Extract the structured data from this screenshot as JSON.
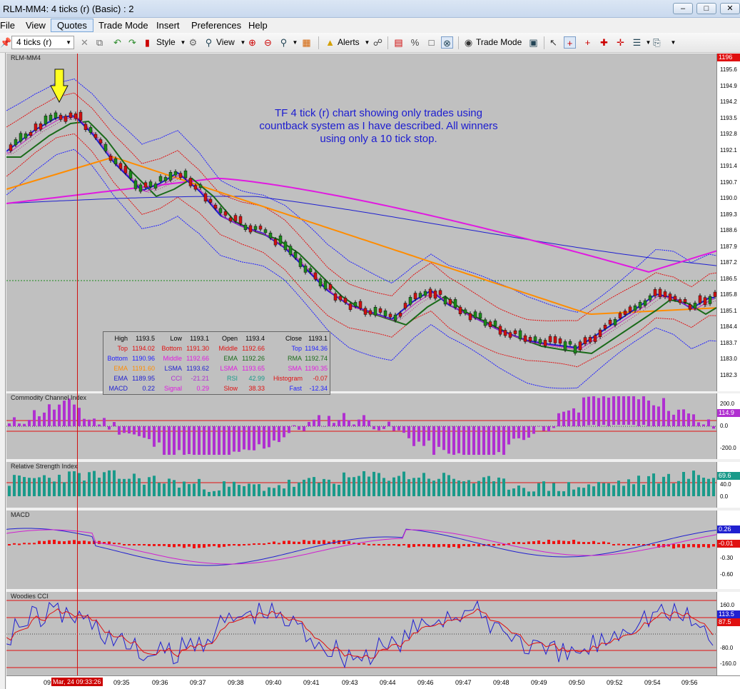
{
  "window": {
    "title": "RLM-MM4: 4 ticks (r) (Basic) : 2",
    "buttons": [
      "–",
      "□",
      "✕"
    ]
  },
  "menu": [
    "File",
    "View",
    "Quotes",
    "Trade Mode",
    "Insert",
    "Preferences",
    "Help"
  ],
  "toolbar": {
    "interval": "4 ticks (r)",
    "style_label": "Style",
    "view_label": "View",
    "alerts_label": "Alerts",
    "trade_mode_label": "Trade Mode"
  },
  "colors": {
    "panel_bg": "#c0c0c0",
    "bands_blue": "#1f1fff",
    "bands_red": "#e01010",
    "ema_green": "#1a6b1a",
    "ema_orange": "#ff8c00",
    "sma_magenta": "#e01ae0",
    "lsma_blue": "#2020d0",
    "cci_bar": "#b030d0",
    "rsi_bar": "#1a9a8a",
    "macd_bar": "#ee1111"
  },
  "main_panel": {
    "label": "RLM-MM4",
    "annotation": "TF 4 tick (r) chart showing only trades using countback system as I have described. All winners using only a 10 tick stop.",
    "price_ticks": [
      "1195.6",
      "1194.9",
      "1194.2",
      "1193.5",
      "1192.8",
      "1192.1",
      "1191.4",
      "1190.7",
      "1190.0",
      "1189.3",
      "1188.6",
      "1187.9",
      "1187.2",
      "1186.5",
      "1185.8",
      "1185.1",
      "1184.4",
      "1183.7",
      "1183.0",
      "1182.3"
    ],
    "last_price_tag": "1196"
  },
  "data_box": {
    "rows": [
      [
        [
          "High",
          "#000"
        ],
        [
          "1193.5",
          "#000"
        ],
        [
          "Low",
          "#000"
        ],
        [
          "1193.1",
          "#000"
        ],
        [
          "Open",
          "#000"
        ],
        [
          "1193.4",
          "#000"
        ],
        [
          "Close",
          "#000"
        ],
        [
          "1193.1",
          "#000"
        ]
      ],
      [
        [
          "Top",
          "#e01010"
        ],
        [
          "1194.02",
          "#e01010"
        ],
        [
          "Bottom",
          "#e01010"
        ],
        [
          "1191.30",
          "#e01010"
        ],
        [
          "Middle",
          "#e01010"
        ],
        [
          "1192.66",
          "#e01010"
        ],
        [
          "Top",
          "#1f1fff"
        ],
        [
          "1194.36",
          "#1f1fff"
        ]
      ],
      [
        [
          "Bottom",
          "#1f1fff"
        ],
        [
          "1190.96",
          "#1f1fff"
        ],
        [
          "Middle",
          "#e01ae0"
        ],
        [
          "1192.66",
          "#e01ae0"
        ],
        [
          "EMA",
          "#1a6b1a"
        ],
        [
          "1192.26",
          "#1a6b1a"
        ],
        [
          "RMA",
          "#1a6b1a"
        ],
        [
          "1192.74",
          "#1a6b1a"
        ]
      ],
      [
        [
          "EMA",
          "#ff8c00"
        ],
        [
          "1191.60",
          "#ff8c00"
        ],
        [
          "LSMA",
          "#2020d0"
        ],
        [
          "1193.62",
          "#2020d0"
        ],
        [
          "LSMA",
          "#e01ae0"
        ],
        [
          "1193.65",
          "#e01ae0"
        ],
        [
          "SMA",
          "#e01ae0"
        ],
        [
          "1190.35",
          "#e01ae0"
        ]
      ],
      [
        [
          "EMA",
          "#2020d0"
        ],
        [
          "1189.95",
          "#2020d0"
        ],
        [
          "CCI",
          "#b030d0"
        ],
        [
          "-21.21",
          "#b030d0"
        ],
        [
          "RSI",
          "#1a9a8a"
        ],
        [
          "42.99",
          "#1a9a8a"
        ],
        [
          "Histogram",
          "#e01010"
        ],
        [
          "-0.07",
          "#e01010"
        ]
      ],
      [
        [
          "MACD",
          "#2020d0"
        ],
        [
          "0.22",
          "#2020d0"
        ],
        [
          "Signal",
          "#e01ae0"
        ],
        [
          "0.29",
          "#e01ae0"
        ],
        [
          "Slow",
          "#e01010"
        ],
        [
          "38.33",
          "#e01010"
        ],
        [
          "Fast",
          "#1f1fff"
        ],
        [
          "-12.34",
          "#1f1fff"
        ]
      ]
    ]
  },
  "cci_panel": {
    "label": "Commodity Channel Index",
    "ticks": [
      "200.0",
      "0.0",
      "-200.0"
    ],
    "tag": "114.9"
  },
  "rsi_panel": {
    "label": "Relative Strength Index",
    "ticks": [
      "40.0",
      "0.0"
    ],
    "tag": "69.6"
  },
  "macd_panel": {
    "label": "MACD",
    "ticks": [
      "0.26",
      "-0.01",
      "-0.30",
      "-0.60"
    ],
    "tag1": "0.26",
    "tag2": "-0.01"
  },
  "woodies_panel": {
    "label": "Woodies CCI",
    "ticks": [
      "160.0",
      "-80.0",
      "-160.0"
    ],
    "tag1": "113.5",
    "tag2": "87.5"
  },
  "time_axis": {
    "cursor_label": "Mar, 24 09:33:26",
    "labels": [
      "09:32",
      "09:35",
      "09:36",
      "09:37",
      "09:38",
      "09:40",
      "09:41",
      "09:43",
      "09:44",
      "09:46",
      "09:47",
      "09:48",
      "09:49",
      "09:50",
      "09:52",
      "09:54",
      "09:56"
    ]
  }
}
